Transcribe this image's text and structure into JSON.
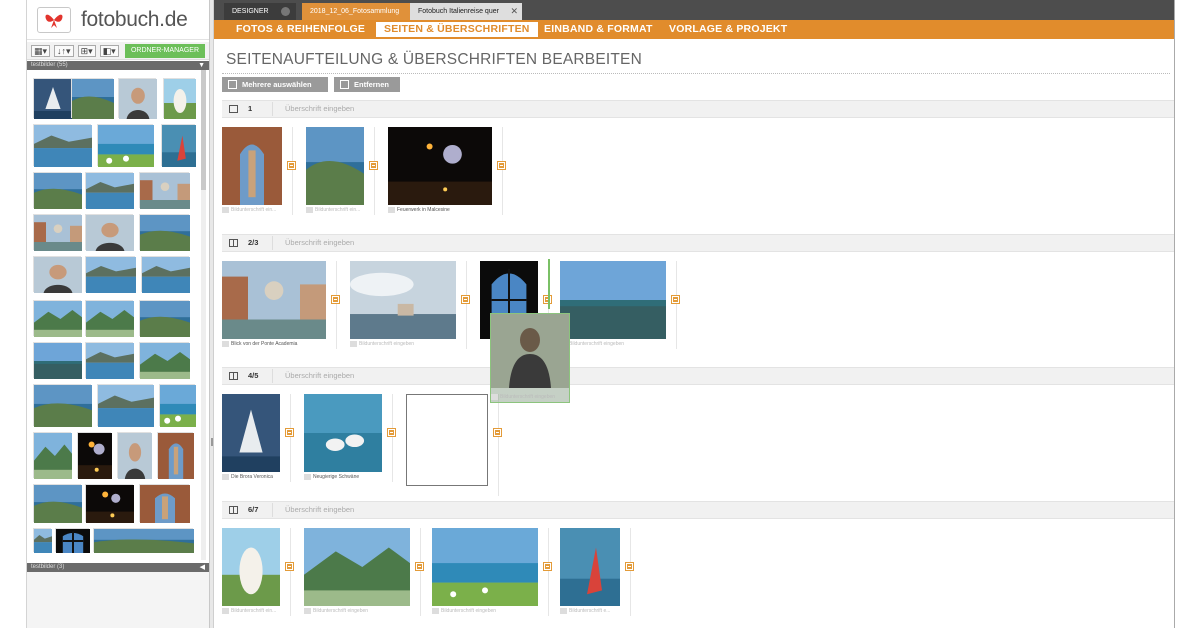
{
  "logo": {
    "text": "fotobuch.de"
  },
  "left_toolbar": {
    "organizer_button": "ORDNER-MANAGER",
    "panel1_label": "testbilder (55)",
    "panel2_label": "testbilder (3)"
  },
  "tabs": [
    {
      "label": "DESIGNER"
    },
    {
      "label": "2018_12_06_Fotosammlung"
    },
    {
      "label": "Fotobuch Italienreise quer",
      "close": "✕"
    }
  ],
  "nav": [
    "FOTOS & REIHENFOLGE",
    "SEITEN & ÜBERSCHRIFTEN",
    "EINBAND & FORMAT",
    "VORLAGE & PROJEKT"
  ],
  "page_title": "SEITENAUFTEILUNG & ÜBERSCHRIFTEN BEARBEITEN",
  "buttons": {
    "select_multiple": "Mehrere auswählen",
    "remove": "Entfernen"
  },
  "spreads": [
    {
      "pages": "1",
      "heading_placeholder": "Überschrift eingeben",
      "captions": [
        "Bildunterschrift ein...",
        "Bildunterschrift ein...",
        "Feuerwerk in Malcesine"
      ]
    },
    {
      "pages": "2/3",
      "heading_placeholder": "Überschrift eingeben",
      "captions": [
        "Blick von der Ponte Academia",
        "Bildunterschrift eingeben",
        "",
        "Bildunterschrift eingeben"
      ]
    },
    {
      "pages": "4/5",
      "heading_placeholder": "Überschrift eingeben",
      "captions": [
        "Die Brora Veronica",
        "Neugierige Schwäne",
        ""
      ]
    },
    {
      "pages": "6/7",
      "heading_placeholder": "Überschrift eingeben",
      "captions": [
        "Bildunterschrift ein...",
        "Bildunterschrift eingeben",
        "Bildunterschrift eingeben",
        "Bildunterschrift e..."
      ]
    }
  ],
  "drag_caption": "Bildunterschrift eingeben",
  "colors": {
    "accent": "#e18c2c",
    "green": "#6cbf59",
    "tabbar": "#4d4d4d"
  }
}
